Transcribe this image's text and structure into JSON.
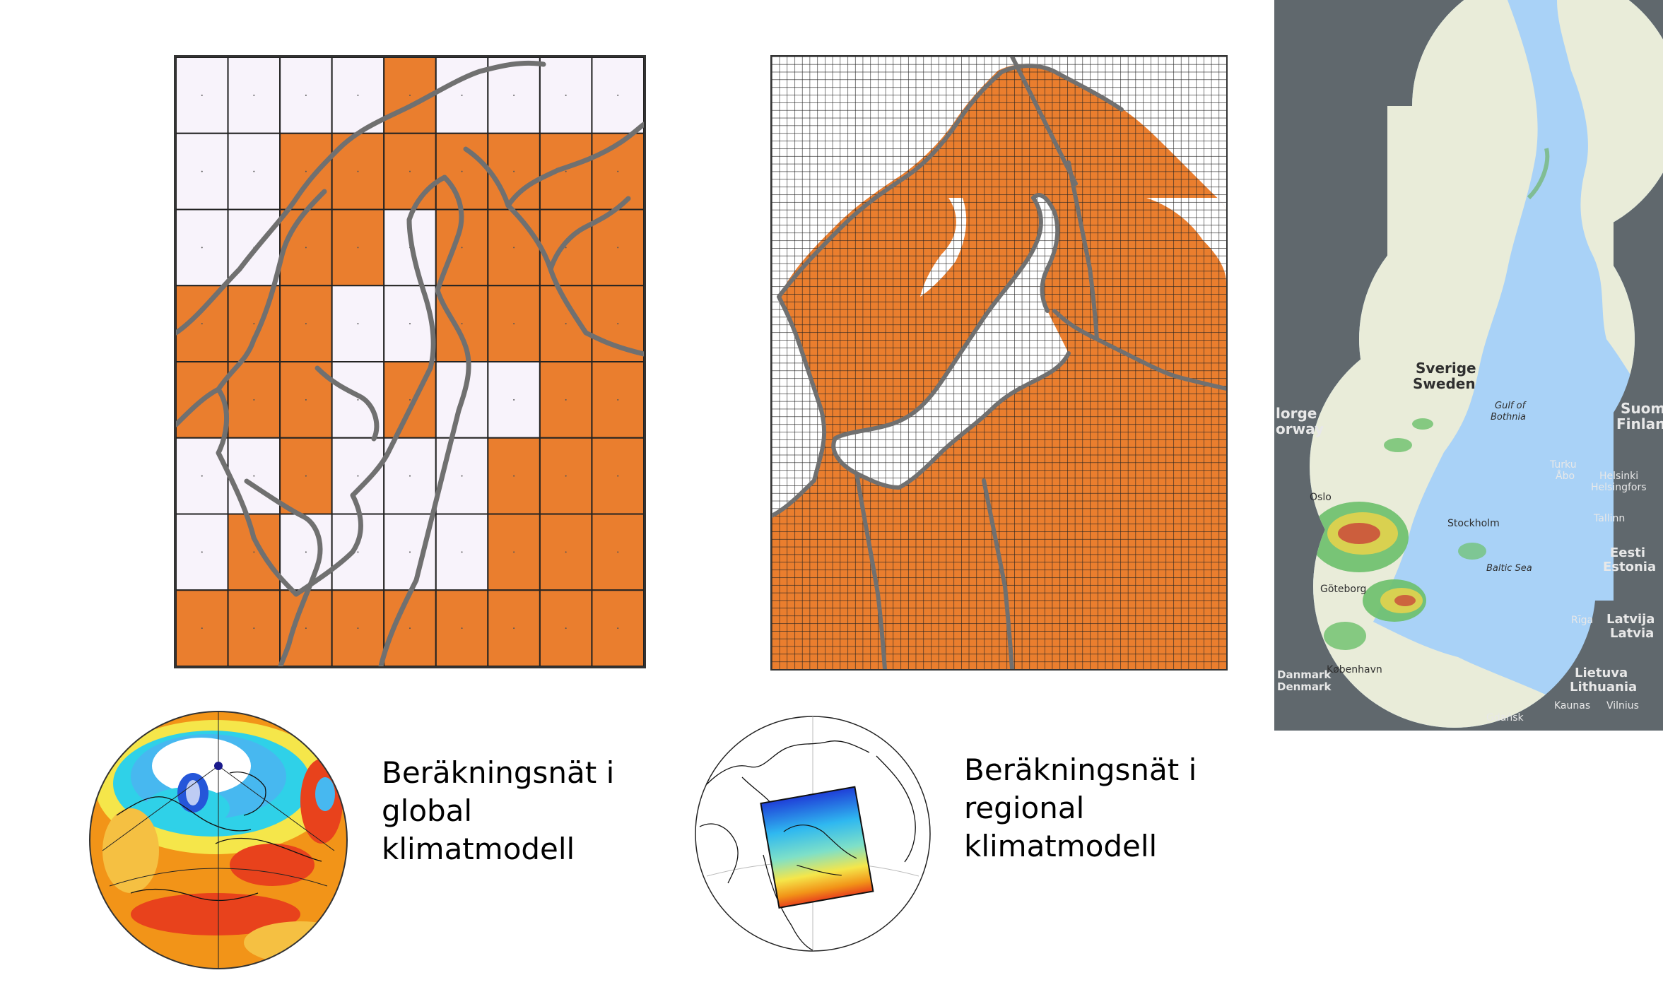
{
  "captions": {
    "global": "Beräkningsnät i\nglobal\nklimatmodell",
    "regional": "Beräkningsnät i\nregional\nklimatmodell"
  },
  "map_labels": {
    "country_se": "Sverige",
    "country_se_en": "Sweden",
    "country_no_1": "lorge",
    "country_no_2": "orway",
    "country_fi": "Suom",
    "country_fi_en": "Finlan",
    "country_ee": "Eesti",
    "country_ee_en": "Estonia",
    "country_lv": "Latvija",
    "country_lv_en": "Latvia",
    "country_lt": "Lietuva",
    "country_lt_en": "Lithuania",
    "country_dk": "Danmark",
    "country_dk_en": "Denmark",
    "sea_gulf": "Gulf of",
    "sea_bothnia": "Bothnia",
    "sea_baltic": "Baltic Sea",
    "city_stockholm": "Stockholm",
    "city_oslo": "Oslo",
    "city_goteborg": "Göteborg",
    "city_kobenhavn": "København",
    "city_helsinki": "Helsinki",
    "city_helsingfors": "Helsingfors",
    "city_turku": "Turku",
    "city_abo": "Åbo",
    "city_tallinn": "Tallinn",
    "city_riga": "Rīga",
    "city_kaunas": "Kaunas",
    "city_vilnius": "Vilnius",
    "city_gdansk": "Gdańsk"
  },
  "colors": {
    "grid_land": "#ea7e2e",
    "grid_sea": "#f8f3fb",
    "coastline": "#707070",
    "radar_water": "#a9d2f7",
    "radar_land": "#e9ecd9"
  },
  "global_grid": {
    "cols": 9,
    "rows": 8,
    "cells": [
      "0000100000",
      "0011111111",
      "0011011111",
      "1110011111",
      "1110100111",
      "0010001111",
      "0100001111",
      "1111111111"
    ]
  },
  "regional_grid": {
    "cols": 60,
    "rows": 80
  }
}
